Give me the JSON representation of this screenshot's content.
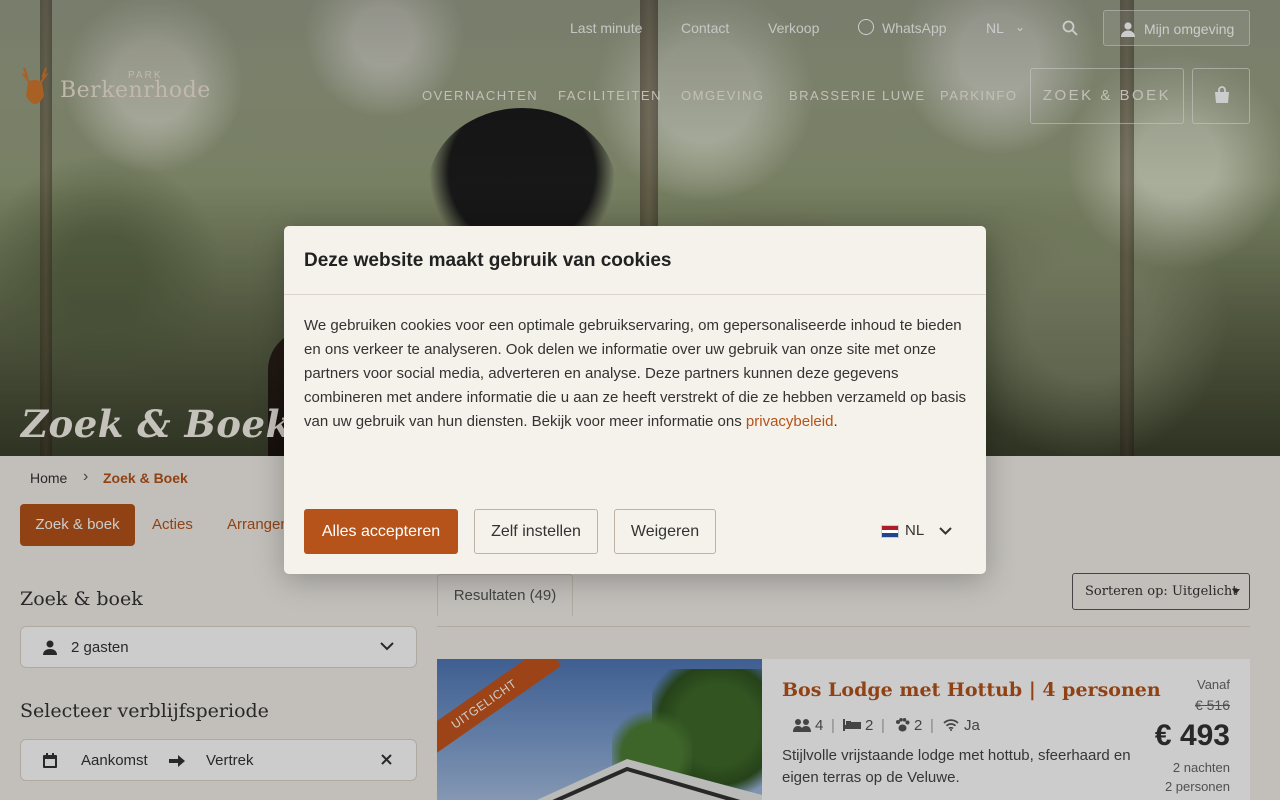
{
  "topbar": {
    "links": [
      "Last minute",
      "Contact",
      "Verkoop"
    ],
    "whatsapp": "WhatsApp",
    "language": "NL",
    "account_label": "Mijn omgeving"
  },
  "logo": {
    "small": "PARK",
    "name": "Berkenrhode"
  },
  "nav": {
    "items": [
      "OVERNACHTEN",
      "FACILITEITEN",
      "OMGEVING",
      "BRASSERIE LUWE",
      "PARKINFO"
    ],
    "cta": "ZOEK & BOEK"
  },
  "hero": {
    "title": "Zoek & Boek"
  },
  "breadcrumb": {
    "home": "Home",
    "current": "Zoek & Boek"
  },
  "tabs": [
    "Zoek & boek",
    "Acties",
    "Arrangementen"
  ],
  "sidebar": {
    "search_heading": "Zoek & boek",
    "guests": "2 gasten",
    "period_heading": "Selecteer verblijfsperiode",
    "arrival": "Aankomst",
    "departure": "Vertrek"
  },
  "results": {
    "tab": "Resultaten (49)",
    "sort": "Sorteren op: Uitgelicht"
  },
  "card": {
    "ribbon": "UITGELICHT",
    "title": "Bos Lodge met Hottub | 4 personen",
    "persons": "4",
    "beds": "2",
    "pets": "2",
    "wifi": "Ja",
    "description": "Stijlvolle vrijstaande lodge met hottub, sfeerhaard en eigen terras op de Veluwe.",
    "from_label": "Vanaf",
    "old_price": "€ 516",
    "price": "€ 493",
    "nights": "2 nachten",
    "people": "2 personen"
  },
  "cookie_modal": {
    "title": "Deze website maakt gebruik van cookies",
    "body": "We gebruiken cookies voor een optimale gebruikservaring, om gepersonaliseerde inhoud te bieden en ons verkeer te analyseren. Ook delen we informatie over uw gebruik van onze site met onze partners voor social media, adverteren en analyse. Deze partners kunnen deze gegevens combineren met andere informatie die u aan ze heeft verstrekt of die ze hebben verzameld op basis van uw gebruik van hun diensten. Bekijk voor meer informatie ons",
    "link": "privacybeleid",
    "after_link": ".",
    "accept": "Alles accepteren",
    "customize": "Zelf instellen",
    "refuse": "Weigeren",
    "language": "NL"
  },
  "colors": {
    "brand": "#b5531a",
    "background": "#f3efe9"
  }
}
